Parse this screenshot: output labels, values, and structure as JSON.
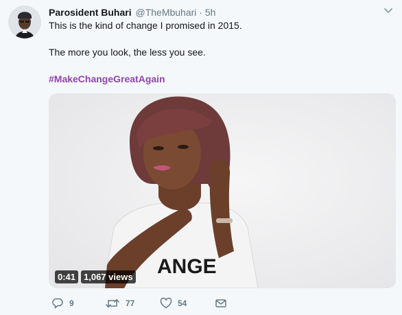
{
  "tweet": {
    "display_name": "Parosident Buhari",
    "handle": "@TheMbuhari",
    "separator": "·",
    "time": "5h",
    "text_line1": "This is the kind of change I promised in 2015.",
    "text_line2": "The more you look, the less you see.",
    "hashtag": "#MakeChangeGreatAgain",
    "hashtag_color": "#8e44ad"
  },
  "media": {
    "duration": "0:41",
    "views": "1,067 views",
    "shirt_text": "ANGE"
  },
  "actions": {
    "reply_count": "9",
    "retweet_count": "77",
    "like_count": "54"
  },
  "icons": {
    "avatar": "avatar",
    "menu": "chevron-down-icon",
    "reply": "reply-icon",
    "retweet": "retweet-icon",
    "like": "heart-icon",
    "message": "envelope-icon"
  }
}
